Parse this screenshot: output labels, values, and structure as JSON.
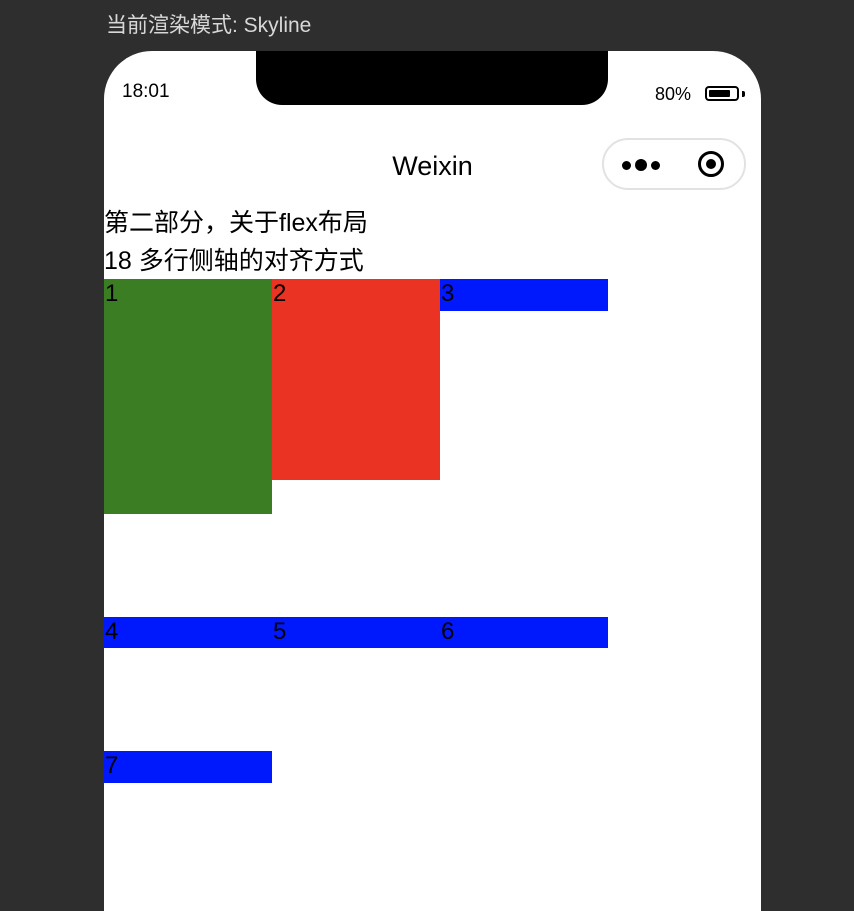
{
  "render_mode_label": "当前渲染模式: Skyline",
  "status_bar": {
    "time": "18:01",
    "battery_percent": "80%",
    "battery_level": 0.8
  },
  "nav": {
    "title": "Weixin",
    "more_icon": "more-dots-icon",
    "close_icon": "target-circle-icon"
  },
  "content": {
    "section_title": "第二部分，关于flex布局",
    "subtitle": "18 多行侧轴的对齐方式",
    "items": [
      {
        "label": "1",
        "color": "#3a7d22"
      },
      {
        "label": "2",
        "color": "#eb3324"
      },
      {
        "label": "3",
        "color": "#0019fc"
      },
      {
        "label": "4",
        "color": "#0019fc"
      },
      {
        "label": "5",
        "color": "#0019fc"
      },
      {
        "label": "6",
        "color": "#0019fc"
      },
      {
        "label": "7",
        "color": "#0019fc"
      }
    ]
  },
  "colors": {
    "background": "#2e2e2e",
    "phone_screen": "#ffffff",
    "green": "#3a7d22",
    "red": "#eb3324",
    "blue": "#0019fc"
  }
}
